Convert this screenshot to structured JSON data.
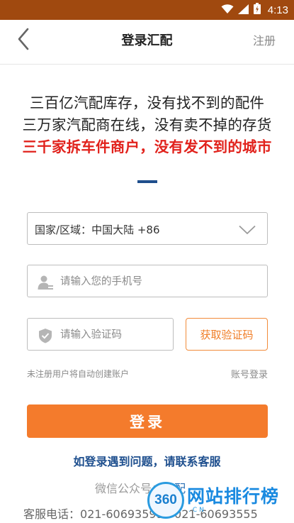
{
  "status_bar": {
    "time": "4:13",
    "icons": [
      "wifi-icon",
      "signal-icon",
      "battery-icon"
    ]
  },
  "header": {
    "title": "登录汇配",
    "back_icon": "back-arrow-icon",
    "register_label": "注册"
  },
  "slogans": [
    "三百亿汽配库存，没有找不到的配件",
    "三万家汽配商在线，没有卖不掉的存货",
    "三千家拆车件商户，没有发不到的城市"
  ],
  "form": {
    "country_label": "国家/区域：",
    "country_value": "中国大陆 +86",
    "phone_placeholder": "请输入您的手机号",
    "code_placeholder": "请输入验证码",
    "get_code_label": "获取验证码",
    "auto_create_note": "未注册用户将自动创建账户",
    "account_login_label": "账号登录",
    "login_button_label": "登录"
  },
  "footer": {
    "help_text": "如登录遇到问题，请联系客服",
    "wechat_label": "微信公众号：",
    "wechat_name": "汇配",
    "service_label": "客服电话：",
    "phone_1": "021-60693599",
    "phone_2": "021-60693555"
  },
  "watermark": {
    "badge": "360",
    "main_text": "网站排行榜",
    "sub_text": ".CN"
  },
  "colors": {
    "status_bar": "#a0490f",
    "accent_orange": "#f47b2c",
    "slogan_red": "#e1221c",
    "help_blue": "#1e4f8e"
  }
}
